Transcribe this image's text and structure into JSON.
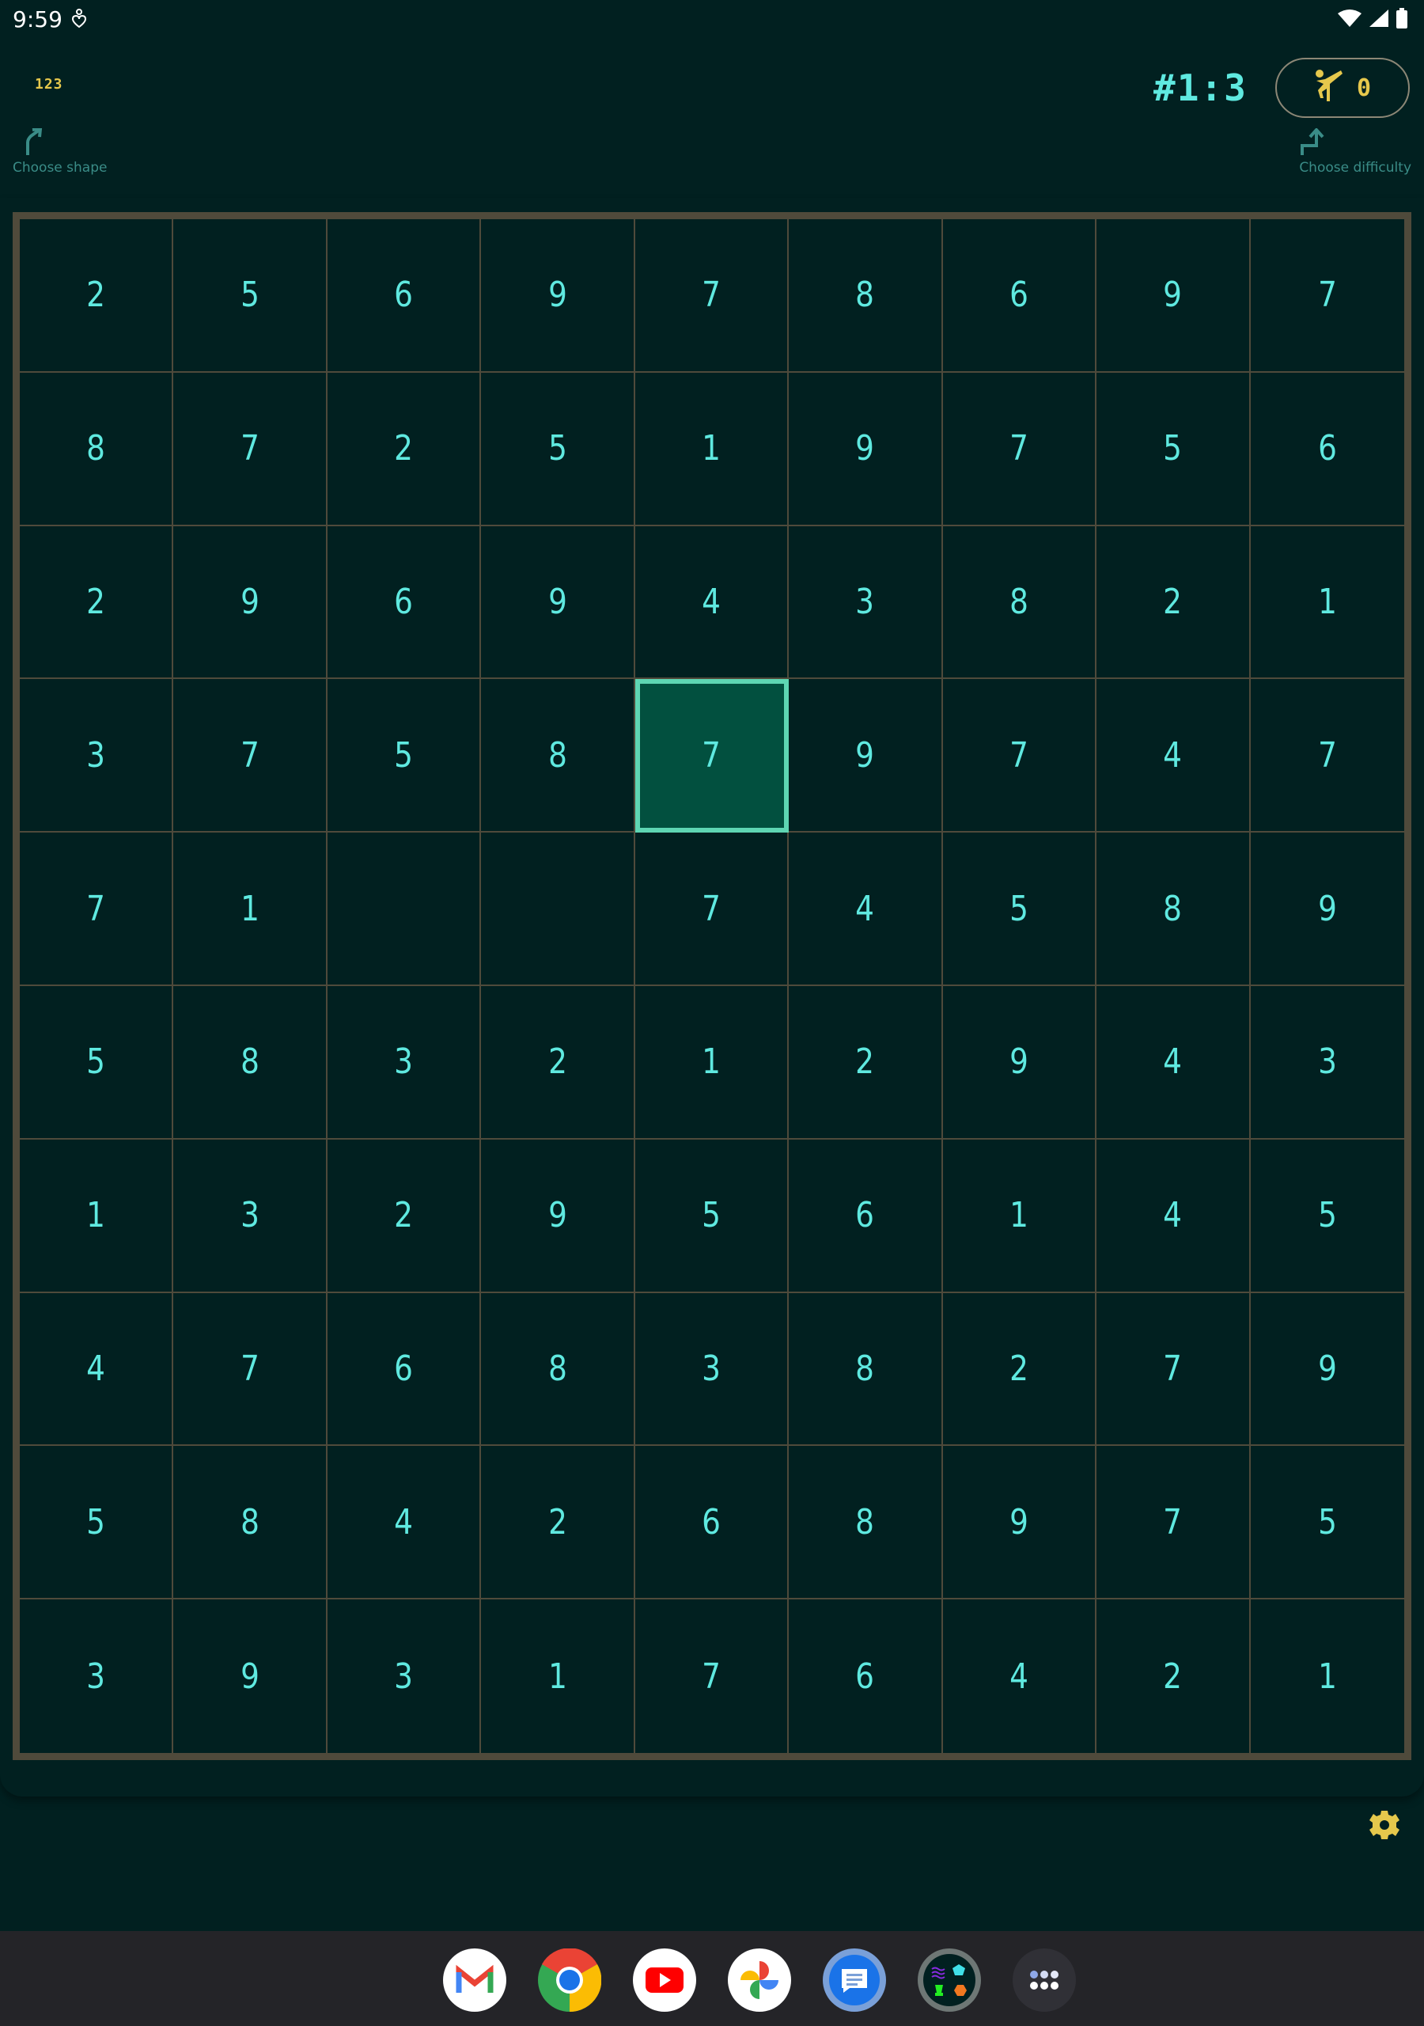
{
  "status_bar": {
    "time": "9:59",
    "icons": [
      "notification-icon",
      "wifi-icon",
      "signal-icon",
      "battery-icon"
    ]
  },
  "header": {
    "shape_button_label": "123",
    "choose_shape_hint": "Choose shape",
    "puzzle_id": "#1:3",
    "difficulty_icon": "martial-arts-kick-icon",
    "difficulty_value": "0",
    "choose_difficulty_hint": "Choose difficulty"
  },
  "board": {
    "columns": 9,
    "rows": 10,
    "selected_cell": {
      "row": 4,
      "col": 5
    },
    "cells": [
      [
        "2",
        "5",
        "6",
        "9",
        "7",
        "8",
        "6",
        "9",
        "7"
      ],
      [
        "8",
        "7",
        "2",
        "5",
        "1",
        "9",
        "7",
        "5",
        "6"
      ],
      [
        "2",
        "9",
        "6",
        "9",
        "4",
        "3",
        "8",
        "2",
        "1"
      ],
      [
        "3",
        "7",
        "5",
        "8",
        "7",
        "9",
        "7",
        "4",
        "7"
      ],
      [
        "7",
        "1",
        "",
        "",
        "7",
        "4",
        "5",
        "8",
        "9"
      ],
      [
        "5",
        "8",
        "3",
        "2",
        "1",
        "2",
        "9",
        "4",
        "3"
      ],
      [
        "1",
        "3",
        "2",
        "9",
        "5",
        "6",
        "1",
        "4",
        "5"
      ],
      [
        "4",
        "7",
        "6",
        "8",
        "3",
        "8",
        "2",
        "7",
        "9"
      ],
      [
        "5",
        "8",
        "4",
        "2",
        "6",
        "8",
        "9",
        "7",
        "5"
      ],
      [
        "3",
        "9",
        "3",
        "1",
        "7",
        "6",
        "4",
        "2",
        "1"
      ]
    ]
  },
  "colors": {
    "background": "#012020",
    "digit": "#5fe9e0",
    "grid_line": "#4f4a3b",
    "selected_fill": "#02503f",
    "selected_border": "#5ed6b3",
    "accent_yellow": "#e6c84c",
    "hint_teal": "#3a8c87"
  },
  "settings_icon": "gear-icon",
  "dock": {
    "apps": [
      {
        "name": "Gmail"
      },
      {
        "name": "Chrome"
      },
      {
        "name": "YouTube"
      },
      {
        "name": "Photos"
      },
      {
        "name": "Messages"
      },
      {
        "name": "Shapes game"
      },
      {
        "name": "All apps"
      }
    ]
  }
}
